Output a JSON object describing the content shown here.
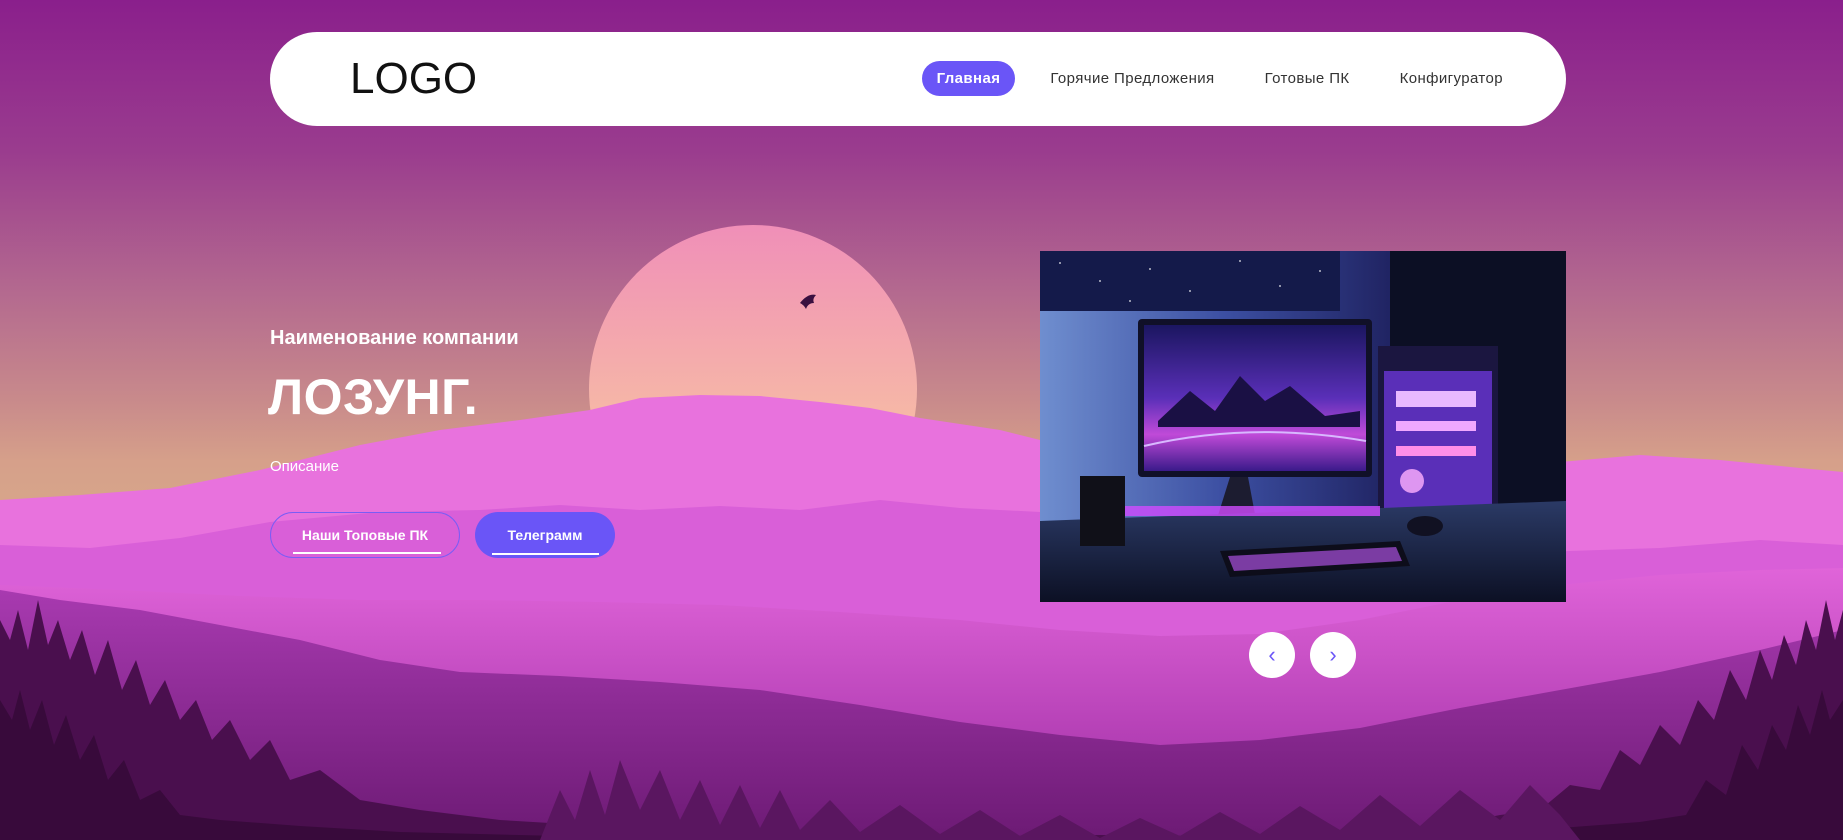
{
  "header": {
    "logo": "LOGO",
    "nav": [
      {
        "label": "Главная",
        "active": true
      },
      {
        "label": "Горячие Предложения",
        "active": false
      },
      {
        "label": "Готовые ПК",
        "active": false
      },
      {
        "label": "Конфигуратор",
        "active": false
      }
    ]
  },
  "hero": {
    "company": "Наименование компании",
    "slogan": "ЛОЗУНГ.",
    "description": "Описание",
    "buttons": {
      "top_pcs": "Наши Топовые ПК",
      "telegram": "Телеграмм"
    }
  },
  "slider": {
    "prev_icon": "chevron-left-icon",
    "next_icon": "chevron-right-icon",
    "prev_glyph": "‹",
    "next_glyph": "›"
  },
  "colors": {
    "accent": "#6a55f7",
    "header_bg": "#ffffff",
    "sky_top": "#8a1f8c",
    "mountain_pink": "#e66fd9",
    "forest_dark": "#3c0a3e"
  }
}
